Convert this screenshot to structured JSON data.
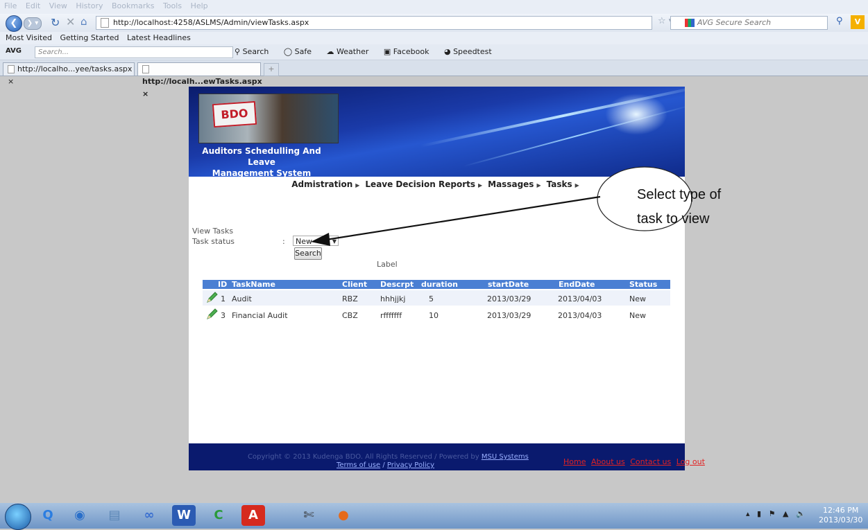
{
  "browser": {
    "menu": [
      "File",
      "Edit",
      "View",
      "History",
      "Bookmarks",
      "Tools",
      "Help"
    ],
    "url": "http://localhost:4258/ASLMS/Admin/viewTasks.aspx",
    "search_placeholder": "AVG Secure Search",
    "bookmarks": [
      "Most Visited",
      "Getting Started",
      "Latest Headlines"
    ],
    "avg_toolbar": {
      "logo": "AVG",
      "search_placeholder": "Search...",
      "items": [
        "Search",
        "Safe",
        "Weather",
        "Facebook",
        "Speedtest"
      ]
    },
    "tabs": [
      "http://localho...yee/tasks.aspx",
      "http://localh...ewTasks.aspx"
    ],
    "new_tab": "+"
  },
  "site": {
    "title_line1": "Auditors Schedulling And Leave",
    "title_line2": "Management System",
    "logo_text": "BDO",
    "menu": [
      "Admistration",
      "Leave Decision Reports",
      "Massages",
      "Tasks"
    ]
  },
  "form": {
    "heading": "View Tasks",
    "status_label": "Task status",
    "colon": ":",
    "status_value": "New",
    "search_button": "Search",
    "label_text": "Label"
  },
  "table": {
    "columns": [
      "ID",
      "TaskName",
      "Client",
      "Descrpt",
      "duration",
      "startDate",
      "EndDate",
      "Status"
    ],
    "rows": [
      {
        "id": "1",
        "name": "Audit",
        "client": "RBZ",
        "desc": "hhhjjkj",
        "duration": "5",
        "start": "2013/03/29",
        "end": "2013/04/03",
        "status": "New"
      },
      {
        "id": "3",
        "name": "Financial Audit",
        "client": "CBZ",
        "desc": "rfffffff",
        "duration": "10",
        "start": "2013/03/29",
        "end": "2013/04/03",
        "status": "New"
      }
    ]
  },
  "footer": {
    "copyright": "Copyright © 2013 Kudenga BDO. All Rights Reserved / Powered by",
    "msu": "MSU Systems",
    "terms": "Terms of use",
    "sep": "/",
    "privacy": "Privacy Policy",
    "nav": [
      "Home",
      "About us",
      "Contact us",
      "Log out"
    ]
  },
  "callout": {
    "line1": "Select type of",
    "line2": "task to view"
  },
  "taskbar": {
    "time": "12:46 PM",
    "date": "2013/03/30"
  },
  "colors": {
    "banner": "#1a3aa8",
    "table_header": "#4a7fd3",
    "footer": "#0a1a6e",
    "footer_nav": "#e22222"
  }
}
